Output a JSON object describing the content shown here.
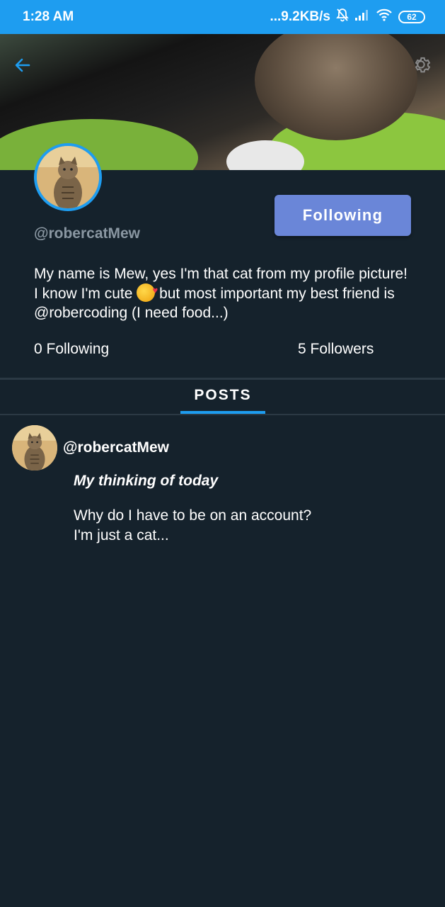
{
  "status_bar": {
    "time": "1:28 AM",
    "network_speed": "...9.2KB/s",
    "battery": "62",
    "icons": [
      "mute-bell-icon",
      "signal-icon",
      "wifi-icon",
      "battery-icon"
    ]
  },
  "header": {
    "back_icon": "arrow-left-icon",
    "settings_icon": "gear-icon"
  },
  "profile": {
    "username": "@robercatMew",
    "follow_button_label": "Following",
    "bio_part1": "My name is Mew, yes I'm that cat from my profile picture! I know I'm cute ",
    "bio_part2": " but most important my best friend is @robercoding (I need food...)",
    "following_count": "0 Following",
    "followers_count": "5 Followers"
  },
  "tabs": [
    {
      "label": "POSTS",
      "active": true
    }
  ],
  "posts": [
    {
      "author": "@robercatMew",
      "title": "My thinking of today",
      "body_line1": "Why do I have to be on an account?",
      "body_line2": "I'm just a cat..."
    }
  ],
  "colors": {
    "accent": "#1e9df0",
    "background": "#15222c",
    "button": "#6a86d8",
    "muted_text": "#8a97a2"
  }
}
